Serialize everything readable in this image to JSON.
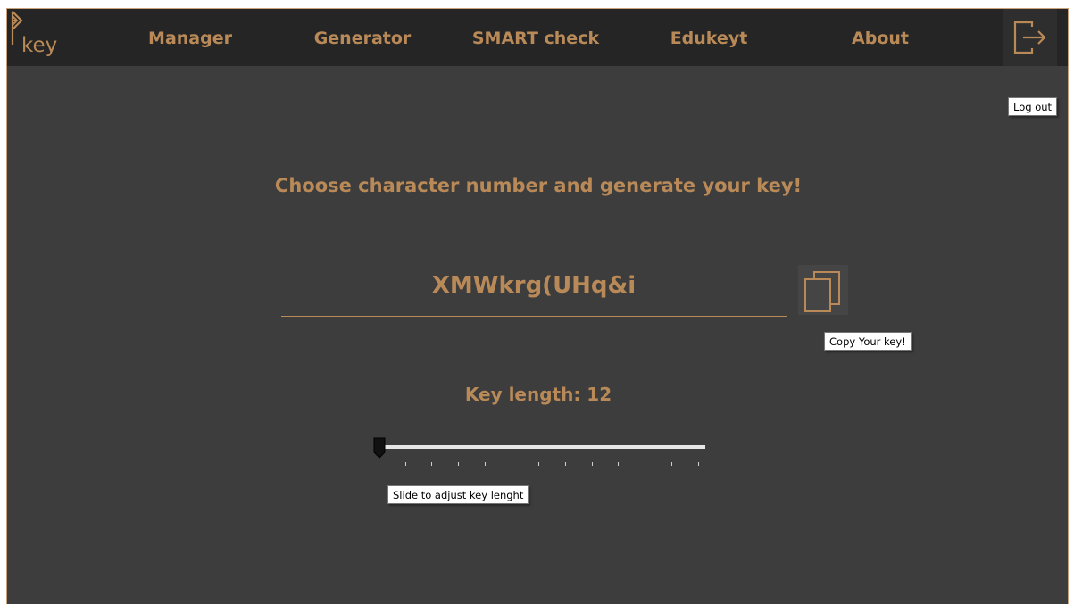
{
  "app": {
    "logo_text": "key"
  },
  "nav": {
    "items": [
      {
        "label": "Manager"
      },
      {
        "label": "Generator"
      },
      {
        "label": "SMART check"
      },
      {
        "label": "Edukeyt"
      },
      {
        "label": "About"
      }
    ]
  },
  "logout": {
    "icon": "logout-icon",
    "tooltip": "Log out"
  },
  "generator": {
    "heading": "Choose character number and generate your key!",
    "generated_key": "XMWkrg(UHq&i",
    "copy_icon": "copy-icon",
    "copy_tooltip": "Copy Your key!",
    "length_label": "Key length: 12",
    "slider": {
      "value": 12,
      "min": 12,
      "max": 25,
      "tooltip": "Slide to adjust key lenght"
    }
  },
  "colors": {
    "accent": "#b98a58",
    "background": "#3d3d3d",
    "topbar": "#252525",
    "track": "#e6e6e6"
  }
}
